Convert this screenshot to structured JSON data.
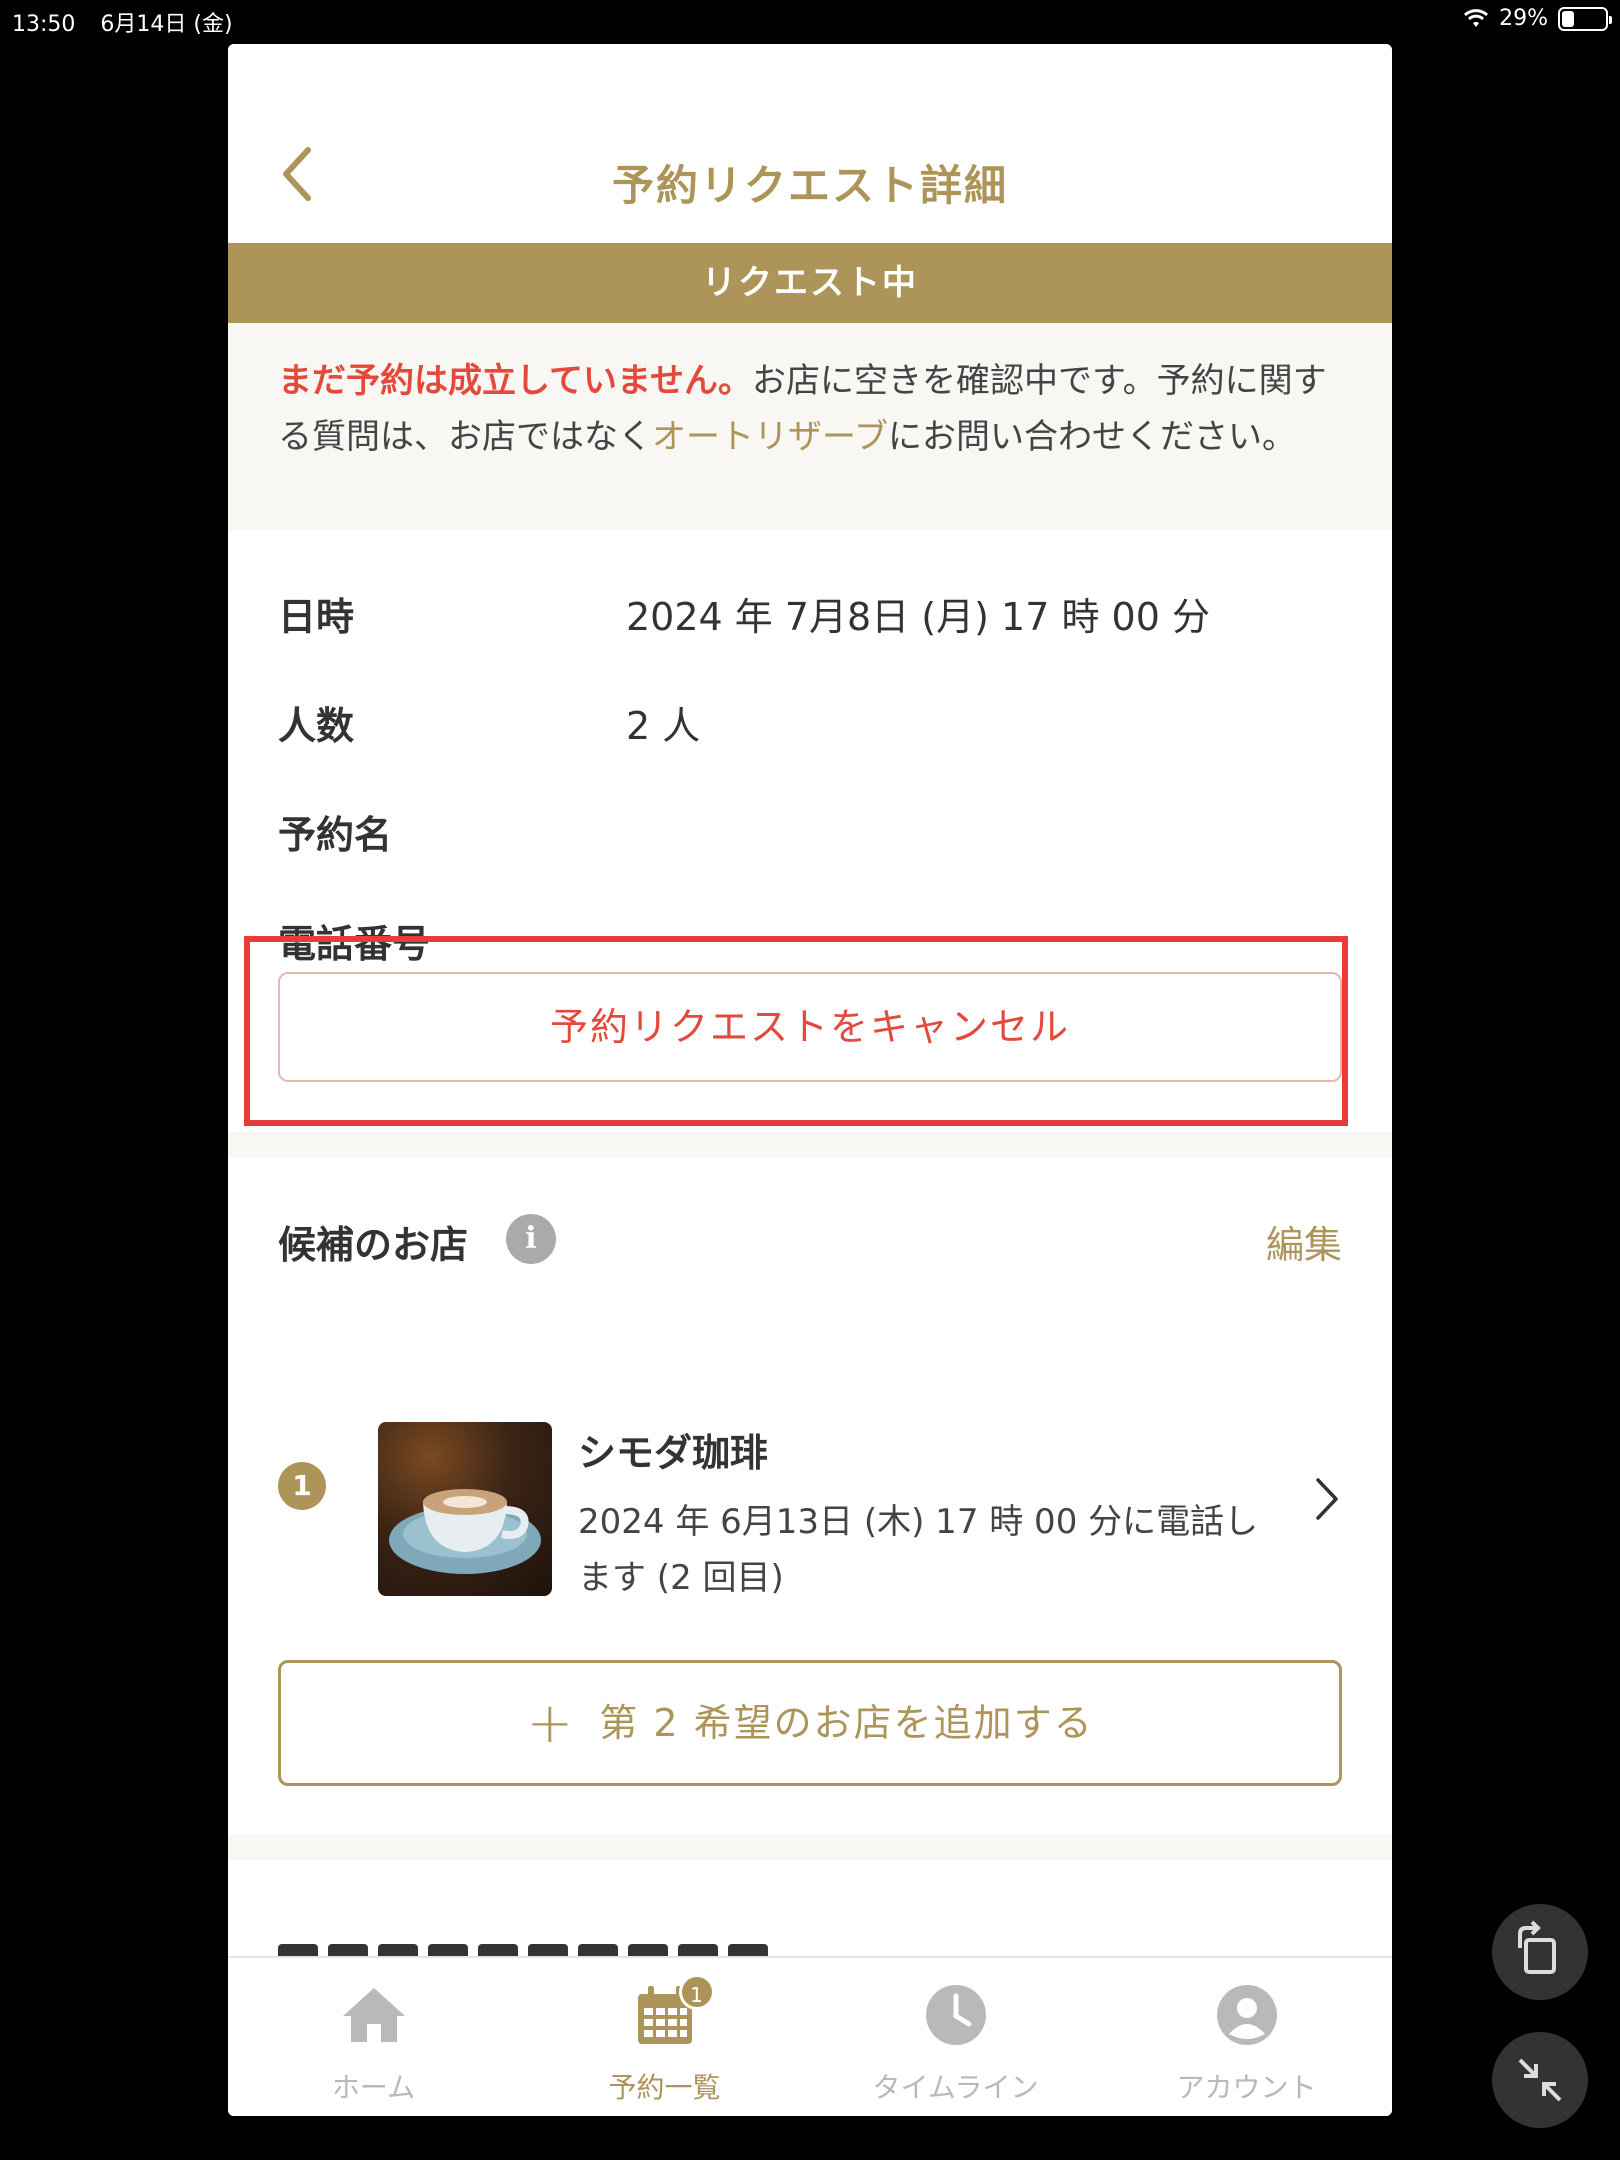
{
  "status_bar": {
    "time": "13:50",
    "date": "6月14日 (金)",
    "battery": "29%",
    "battery_level": 0.29
  },
  "header": {
    "title": "予約リクエスト詳細"
  },
  "banner": {
    "label": "リクエスト中"
  },
  "notice": {
    "warning": "まだ予約は成立していません。",
    "text_1": "お店に空きを確認中です。予約に関する質問は、お店ではなく",
    "link": "オートリザーブ",
    "text_2": "にお問い合わせください。"
  },
  "details": [
    {
      "label": "日時",
      "value": "2024 年 7月8日 (月) 17 時 00 分"
    },
    {
      "label": "人数",
      "value": "2 人"
    },
    {
      "label": "予約名",
      "value": ""
    },
    {
      "label": "電話番号",
      "value": ""
    }
  ],
  "cancel_button": "予約リクエストをキャンセル",
  "candidates": {
    "title": "候補のお店",
    "info_glyph": "i",
    "edit_label": "編集",
    "shops": [
      {
        "rank": "1",
        "name": "シモダ珈琲",
        "desc": "2024 年 6月13日 (木) 17 時 00 分に電話します (2 回目)"
      }
    ],
    "add_button": "第 2 希望のお店を追加する"
  },
  "tabbar": {
    "tabs": [
      {
        "label": "ホーム",
        "icon": "home-icon"
      },
      {
        "label": "予約一覧",
        "icon": "calendar-icon",
        "badge": "1"
      },
      {
        "label": "タイムライン",
        "icon": "clock-icon"
      },
      {
        "label": "アカウント",
        "icon": "account-icon"
      }
    ]
  },
  "colors": {
    "brand": "#ad9459",
    "warning": "#e34a3c",
    "highlight": "#ea3b37"
  }
}
